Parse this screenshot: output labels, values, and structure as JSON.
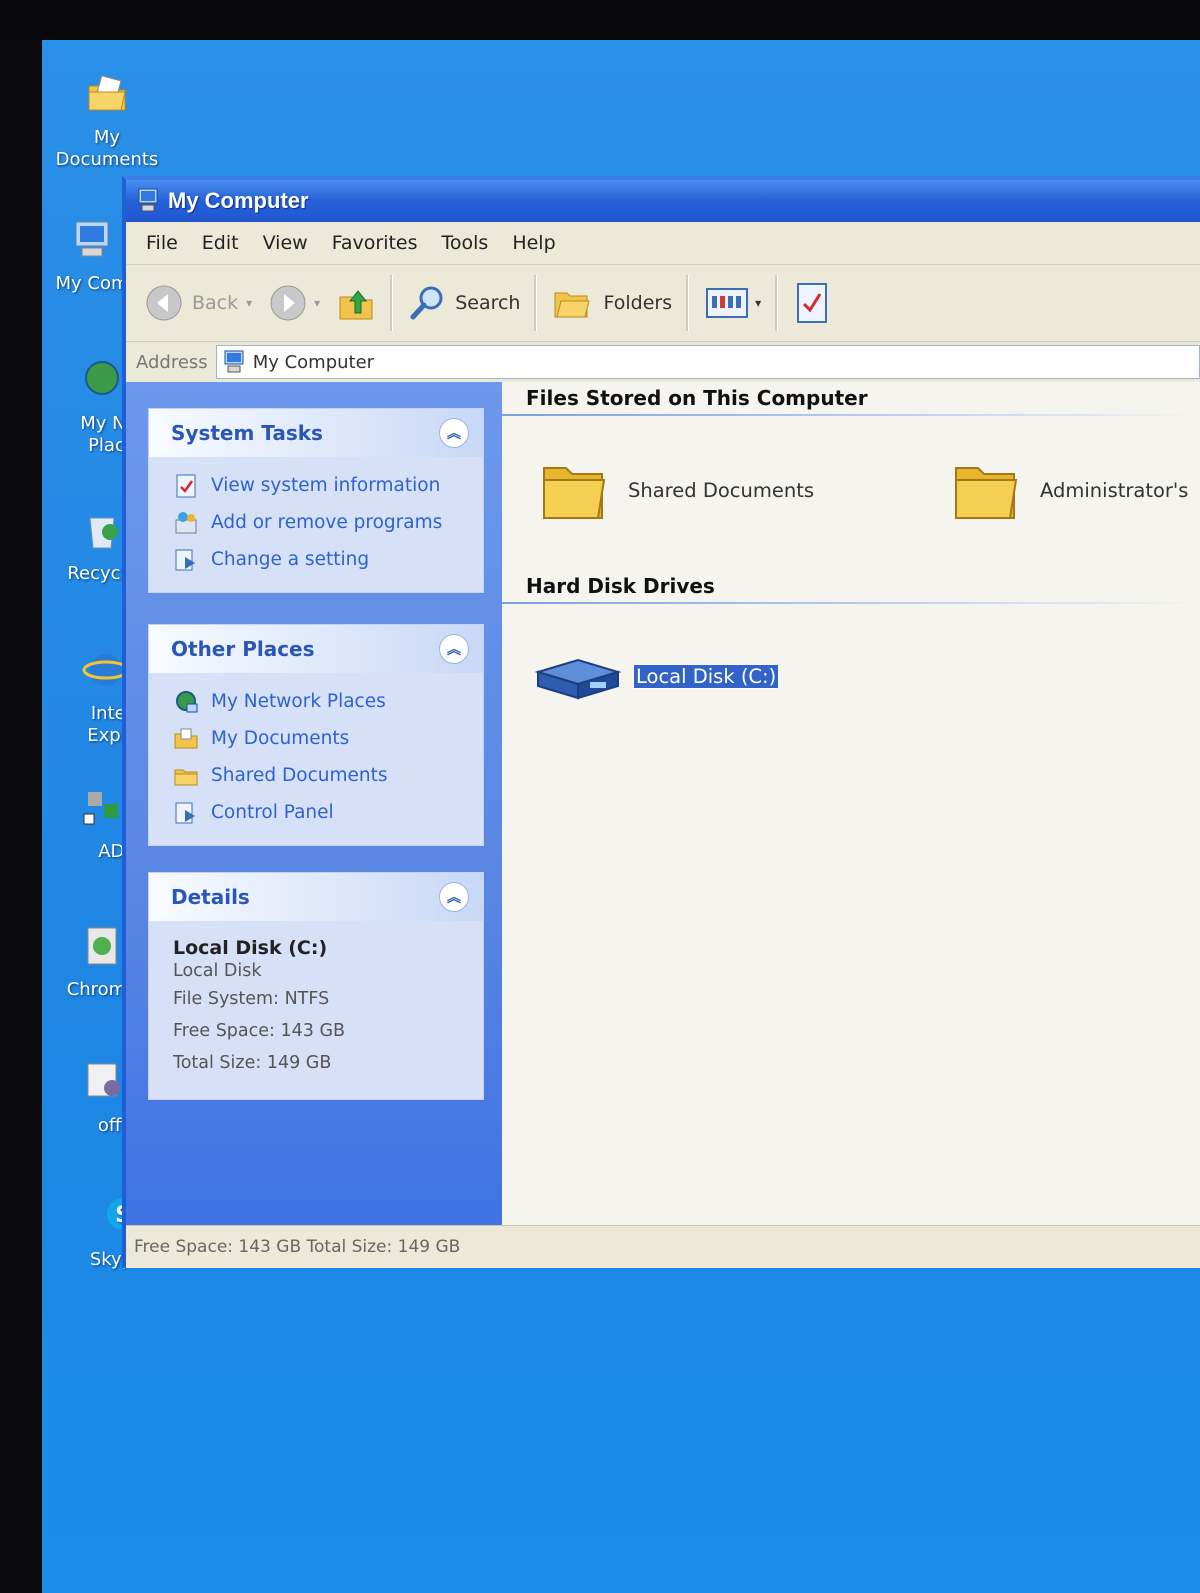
{
  "desktop": {
    "icons": [
      {
        "label": "My Documents",
        "icon": "folder-docs-icon"
      },
      {
        "label": "My Com",
        "icon": "computer-icon"
      },
      {
        "label": "My Net Place",
        "icon": "network-icon"
      },
      {
        "label": "Recycle",
        "icon": "recycle-bin-icon"
      },
      {
        "label": "Inter Explo",
        "icon": "ie-icon"
      },
      {
        "label": "ADS",
        "icon": "ads-icon"
      },
      {
        "label": "Chrome",
        "icon": "chrome-icon"
      },
      {
        "label": "offic",
        "icon": "office-icon"
      },
      {
        "label": "Skype",
        "icon": "skype-icon"
      }
    ]
  },
  "window": {
    "title": "My Computer",
    "menu": [
      "File",
      "Edit",
      "View",
      "Favorites",
      "Tools",
      "Help"
    ],
    "toolbar": {
      "back": "Back",
      "search": "Search",
      "folders": "Folders"
    },
    "address": {
      "label": "Address",
      "value": "My Computer"
    },
    "tasks": {
      "system": {
        "title": "System Tasks",
        "items": [
          "View system information",
          "Add or remove programs",
          "Change a setting"
        ]
      },
      "other": {
        "title": "Other Places",
        "items": [
          "My Network Places",
          "My Documents",
          "Shared Documents",
          "Control Panel"
        ]
      },
      "details": {
        "title": "Details",
        "name": "Local Disk (C:)",
        "type": "Local Disk",
        "fs": "File System: NTFS",
        "free": "Free Space: 143 GB",
        "total": "Total Size: 149 GB"
      }
    },
    "content": {
      "files_header": "Files Stored on This Computer",
      "files": [
        "Shared Documents",
        "Administrator's"
      ],
      "drives_header": "Hard Disk Drives",
      "drives": [
        "Local Disk (C:)"
      ]
    },
    "status": "Free Space: 143 GB Total Size: 149 GB"
  },
  "colors": {
    "desktop": "#1f86e4",
    "titlebar": "#2560d8",
    "task_link": "#2e62d0",
    "selection": "#3163c9"
  }
}
